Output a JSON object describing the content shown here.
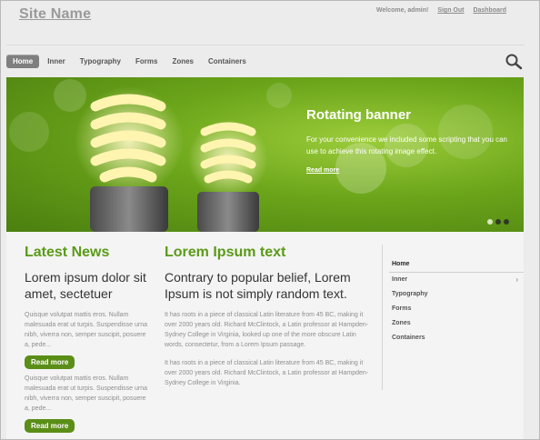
{
  "header": {
    "site_name": "Site Name",
    "welcome": "Welcome, admin!",
    "sign_out": "Sign Out",
    "dashboard": "Dashboard"
  },
  "nav": {
    "items": [
      "Home",
      "Inner",
      "Typography",
      "Forms",
      "Zones",
      "Containers"
    ],
    "active_index": 0
  },
  "banner": {
    "title": "Rotating banner",
    "text": "For your convenience we included some scripting that you can use to achieve this rotating image effect.",
    "link": "Read more",
    "slides": 3,
    "active_slide": 0,
    "accent": "#6ba51a"
  },
  "latest_news": {
    "title": "Latest News",
    "headline": "Lorem ipsum dolor sit amet, sectetuer",
    "items": [
      {
        "text": "Quisque volutpat mattis eros. Nullam malesuada erat ut turpis. Suspendisse urna nibh, viverra non, semper suscipit, posuere a, pede...",
        "button": "Read more"
      },
      {
        "text": "Quisque volutpat mattis eros. Nullam malesuada erat ut turpis. Suspendisse urna nibh, viverra non, semper suscipit, posuere a, pede...",
        "button": "Read more"
      }
    ]
  },
  "lorem": {
    "title": "Lorem Ipsum text",
    "headline": "Contrary to popular belief, Lorem Ipsum is not simply random text.",
    "paragraphs": [
      "It has roots in a piece of classical Latin literature from 45 BC, making it over 2000 years old. Richard McClintock, a Latin professor at Hampden-Sydney College in Virginia, looked up one of the more obscure Latin words, consectetur, from a Lorem Ipsum passage.",
      "It has roots in a piece of classical Latin literature from 45 BC, making it over 2000 years old. Richard McClintock, a Latin professor at Hampden-Sydney College in Virginia."
    ]
  },
  "sidenav": {
    "items": [
      "Home",
      "Inner",
      "Typography",
      "Forms",
      "Zones",
      "Containers"
    ],
    "active_index": 0,
    "submenu_indicator": "›"
  },
  "colors": {
    "accent_green": "#5a9a17",
    "button_green": "#5b8e17"
  }
}
